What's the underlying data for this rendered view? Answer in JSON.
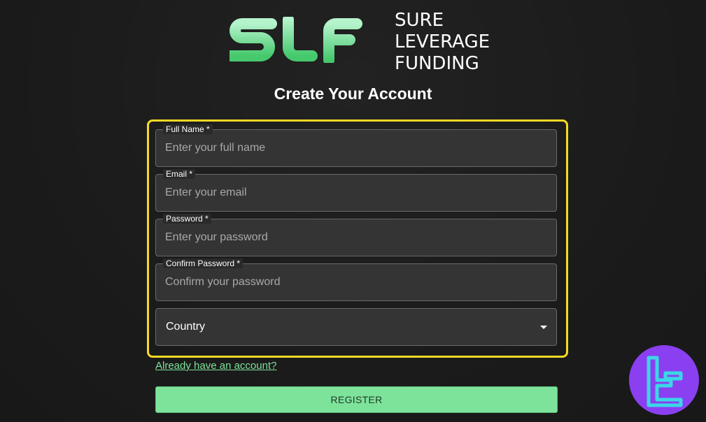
{
  "logo": {
    "mark_text": "SLF",
    "name_lines": [
      "SURE",
      "LEVERAGE",
      "FUNDING"
    ],
    "mark_color_top": "#a8f0c4",
    "mark_color_bottom": "#4ccf74"
  },
  "page_title": "Create Your Account",
  "form": {
    "highlight_color": "#f5d922",
    "fields": [
      {
        "label": "Full Name *",
        "placeholder": "Enter your full name",
        "value": ""
      },
      {
        "label": "Email *",
        "placeholder": "Enter your email",
        "value": ""
      },
      {
        "label": "Password *",
        "placeholder": "Enter your password",
        "value": ""
      },
      {
        "label": "Confirm Password *",
        "placeholder": "Confirm your password",
        "value": ""
      }
    ],
    "country": {
      "selected": "Country",
      "icon": "chevron-down-icon"
    },
    "login_link": "Already have an account?",
    "register_label": "REGISTER"
  },
  "badge": {
    "icon": "tradingfinder-logo-icon",
    "color": "#8a3ff0"
  }
}
